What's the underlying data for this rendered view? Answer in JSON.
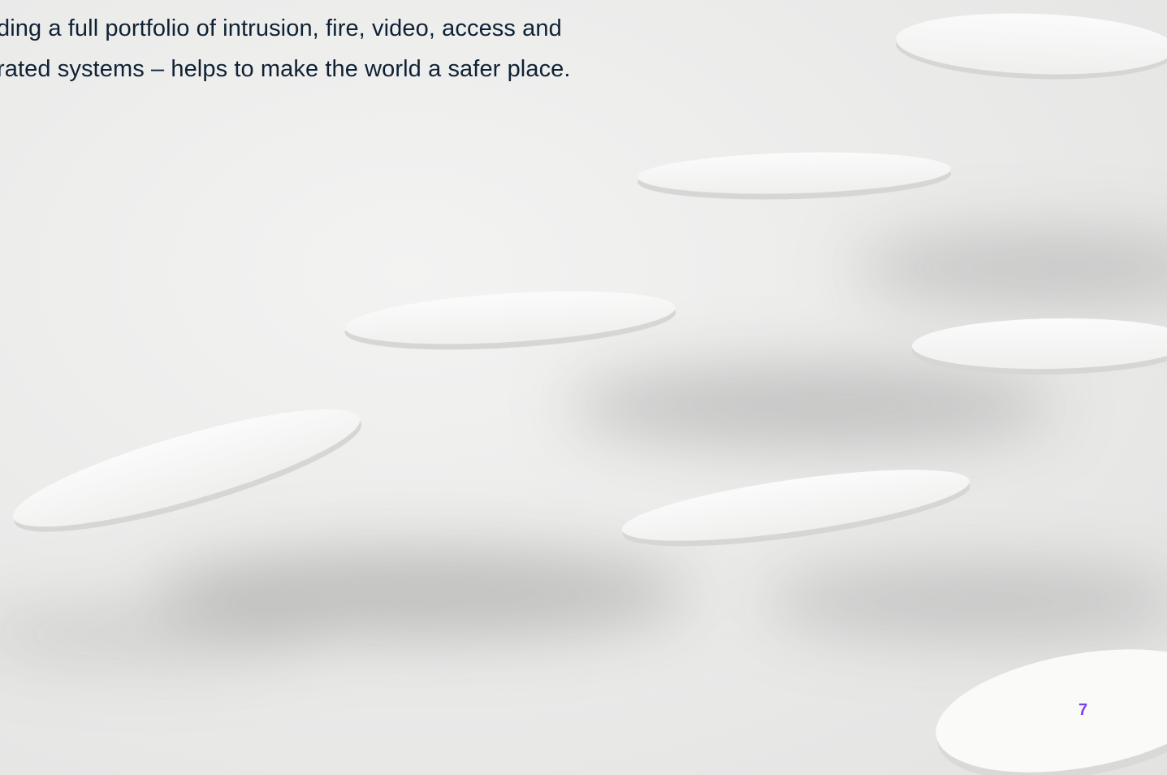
{
  "page": {
    "intro_lines": [
      "ding a full portfolio of intrusion, fire, video, access and",
      "rated systems – helps to make the world a safer place."
    ],
    "page_number": "7"
  },
  "colors": {
    "background": "#ebebea",
    "text": "#0f2235",
    "page_number": "#7b3ff2",
    "disc": "#f8f8f7"
  }
}
